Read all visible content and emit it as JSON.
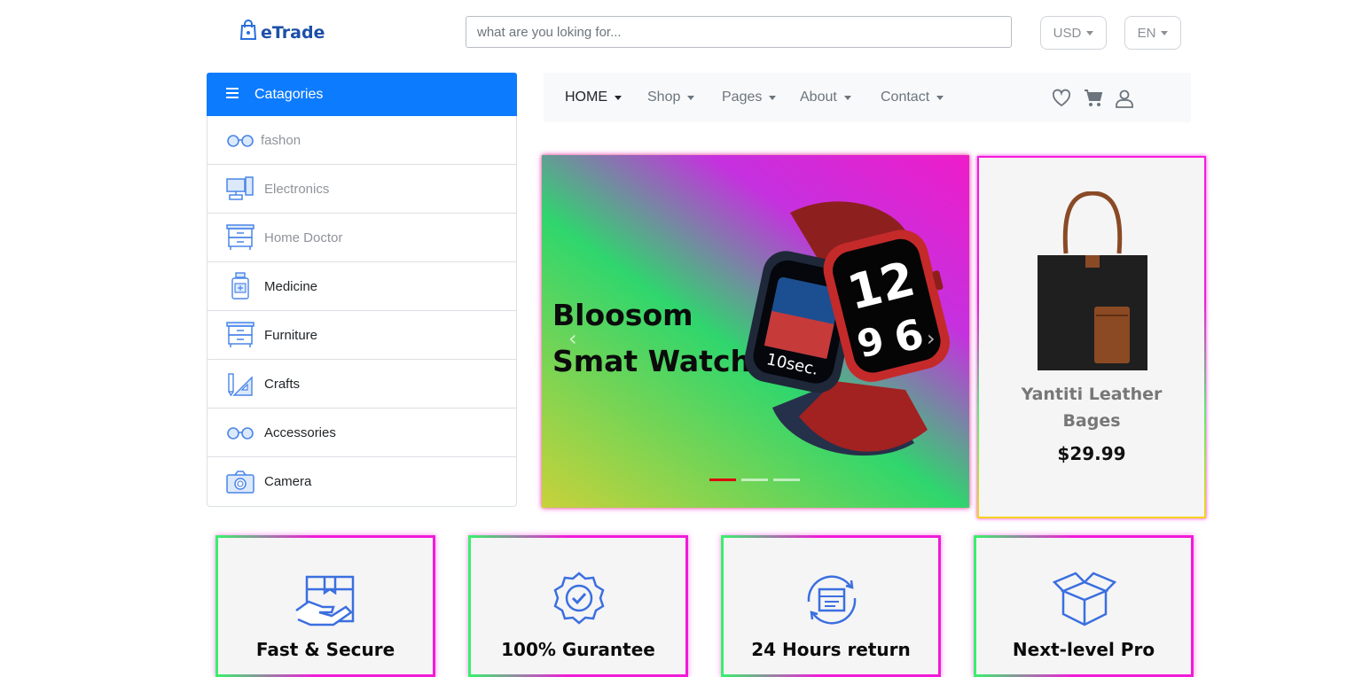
{
  "header": {
    "logo_text": "eTrade",
    "search_placeholder": "what are you loking for...",
    "currency": "USD",
    "language": "EN"
  },
  "categories": {
    "title": "Catagories",
    "items": [
      {
        "label": "fashon",
        "icon": "glasses-icon",
        "muted": true
      },
      {
        "label": "Electronics",
        "icon": "computer-icon",
        "muted": true
      },
      {
        "label": "Home Doctor",
        "icon": "drawer-icon",
        "muted": true
      },
      {
        "label": "Medicine",
        "icon": "medicine-bottle-icon",
        "muted": false
      },
      {
        "label": "Furniture",
        "icon": "drawer-icon",
        "muted": false
      },
      {
        "label": "Crafts",
        "icon": "ruler-pencil-icon",
        "muted": false
      },
      {
        "label": "Accessories",
        "icon": "glasses-icon",
        "muted": false
      },
      {
        "label": "Camera",
        "icon": "camera-icon",
        "muted": false
      }
    ]
  },
  "nav": {
    "items": [
      {
        "label": "HOME",
        "active": true
      },
      {
        "label": "Shop",
        "active": false
      },
      {
        "label": "Pages",
        "active": false
      },
      {
        "label": "About",
        "active": false
      },
      {
        "label": "Contact",
        "active": false
      }
    ],
    "icons": [
      "heart-icon",
      "cart-icon",
      "user-icon"
    ]
  },
  "hero": {
    "title_line1": "Bloosom",
    "title_line2": "Smat Watch",
    "watch_face_text": "10sec.",
    "slides_count": 3,
    "active_slide": 1
  },
  "product": {
    "name_line1": "Yantiti Leather",
    "name_line2": "Bages",
    "price": "$29.99"
  },
  "features": [
    {
      "label": "Fast & Secure",
      "icon": "secure-box-hand-icon"
    },
    {
      "label": "100% Gurantee",
      "icon": "guarantee-badge-icon"
    },
    {
      "label": "24 Hours return",
      "icon": "return-box-icon"
    },
    {
      "label": "Next-level Pro",
      "icon": "open-box-icon"
    }
  ],
  "colors": {
    "brand": "#1c4fa8",
    "accent": "#0d7bfe",
    "icon_blue": "#3b82f6"
  }
}
